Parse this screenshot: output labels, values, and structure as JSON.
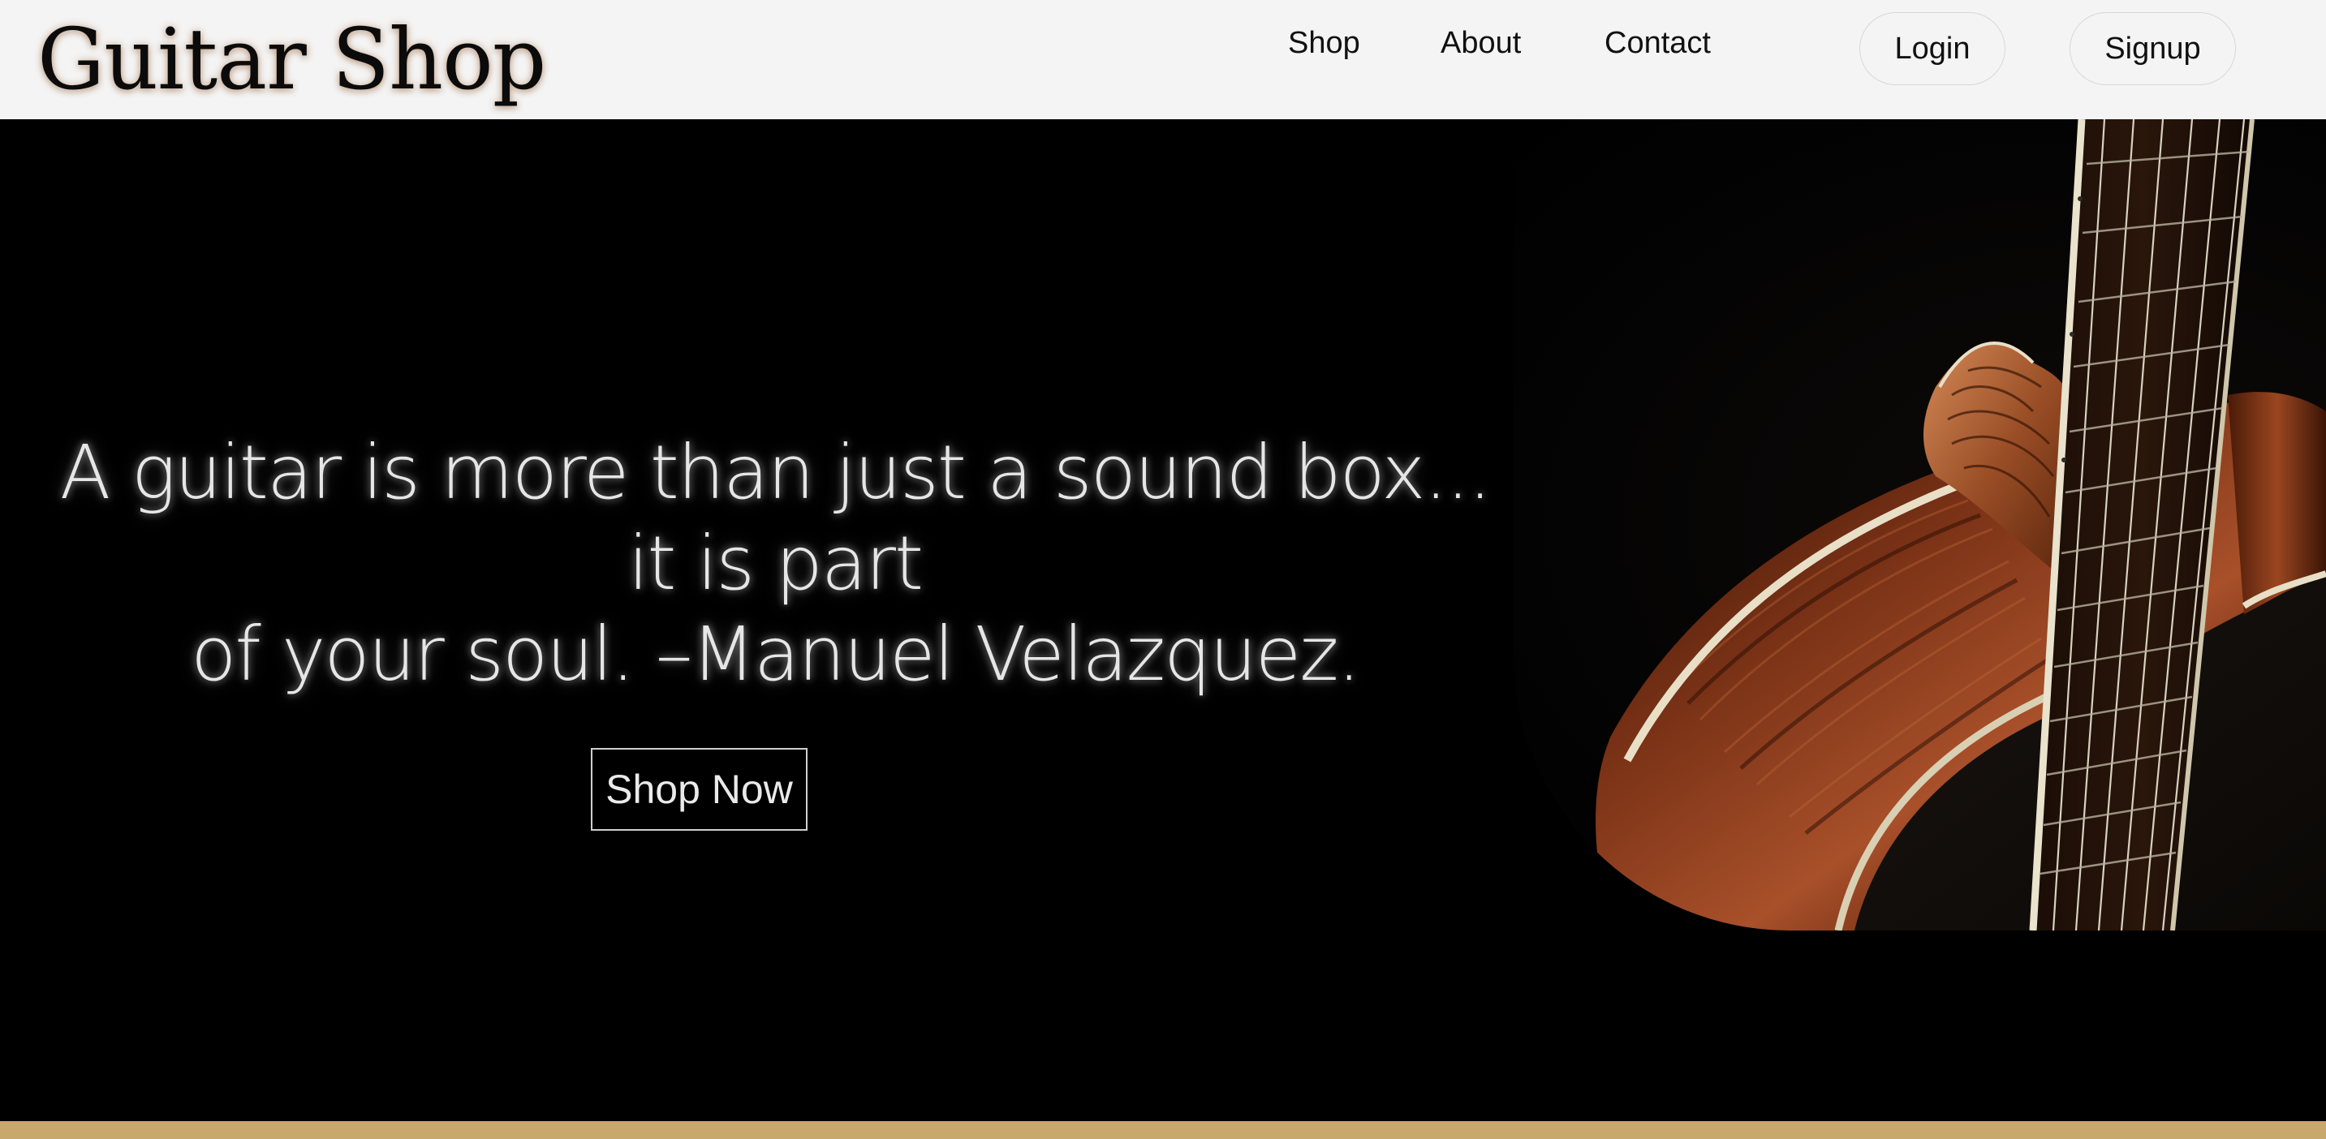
{
  "header": {
    "logo": "Guitar Shop",
    "nav": {
      "shop": "Shop",
      "about": "About",
      "contact": "Contact"
    },
    "login_label": "Login",
    "signup_label": "Signup"
  },
  "hero": {
    "quote_line1": "A guitar is more than just a sound box... it is part",
    "quote_line2": "of your soul. –Manuel Velazquez.",
    "cta_label": "Shop Now"
  },
  "colors": {
    "header_bg": "#f4f4f4",
    "hero_bg": "#000000",
    "accent_band": "#c9a86e",
    "wood": "#6b2a12"
  }
}
